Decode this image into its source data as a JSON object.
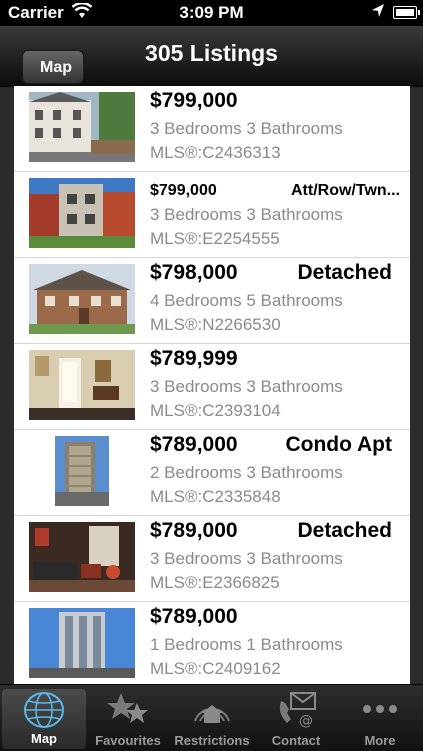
{
  "status": {
    "carrier": "Carrier",
    "time": "3:09 PM"
  },
  "nav": {
    "back_label": "Map",
    "title": "305 Listings"
  },
  "listings": [
    {
      "price": "$799,000",
      "type": "",
      "beds": "3 Bedrooms 3 Bathrooms",
      "mls": "MLS®:C2436313"
    },
    {
      "price": "$799,000",
      "type": "Att/Row/Twn...",
      "beds": "3 Bedrooms 3 Bathrooms",
      "mls": "MLS®:E2254555"
    },
    {
      "price": "$798,000",
      "type": "Detached",
      "beds": "4 Bedrooms 5 Bathrooms",
      "mls": "MLS®:N2266530"
    },
    {
      "price": "$789,999",
      "type": "",
      "beds": "3 Bedrooms 3 Bathrooms",
      "mls": "MLS®:C2393104"
    },
    {
      "price": "$789,000",
      "type": "Condo Apt",
      "beds": "2 Bedrooms 3 Bathrooms",
      "mls": "MLS®:C2335848"
    },
    {
      "price": "$789,000",
      "type": "Detached",
      "beds": "3 Bedrooms 3 Bathrooms",
      "mls": "MLS®:E2366825"
    },
    {
      "price": "$789,000",
      "type": "",
      "beds": "1 Bedrooms 1 Bathrooms",
      "mls": "MLS®:C2409162"
    }
  ],
  "tabs": [
    {
      "label": "Map",
      "icon": "globe-icon",
      "active": true
    },
    {
      "label": "Favourites",
      "icon": "stars-icon",
      "active": false
    },
    {
      "label": "Restrictions",
      "icon": "house-signal-icon",
      "active": false
    },
    {
      "label": "Contact",
      "icon": "phone-mail-icon",
      "active": false
    },
    {
      "label": "More",
      "icon": "more-dots-icon",
      "active": false
    }
  ]
}
